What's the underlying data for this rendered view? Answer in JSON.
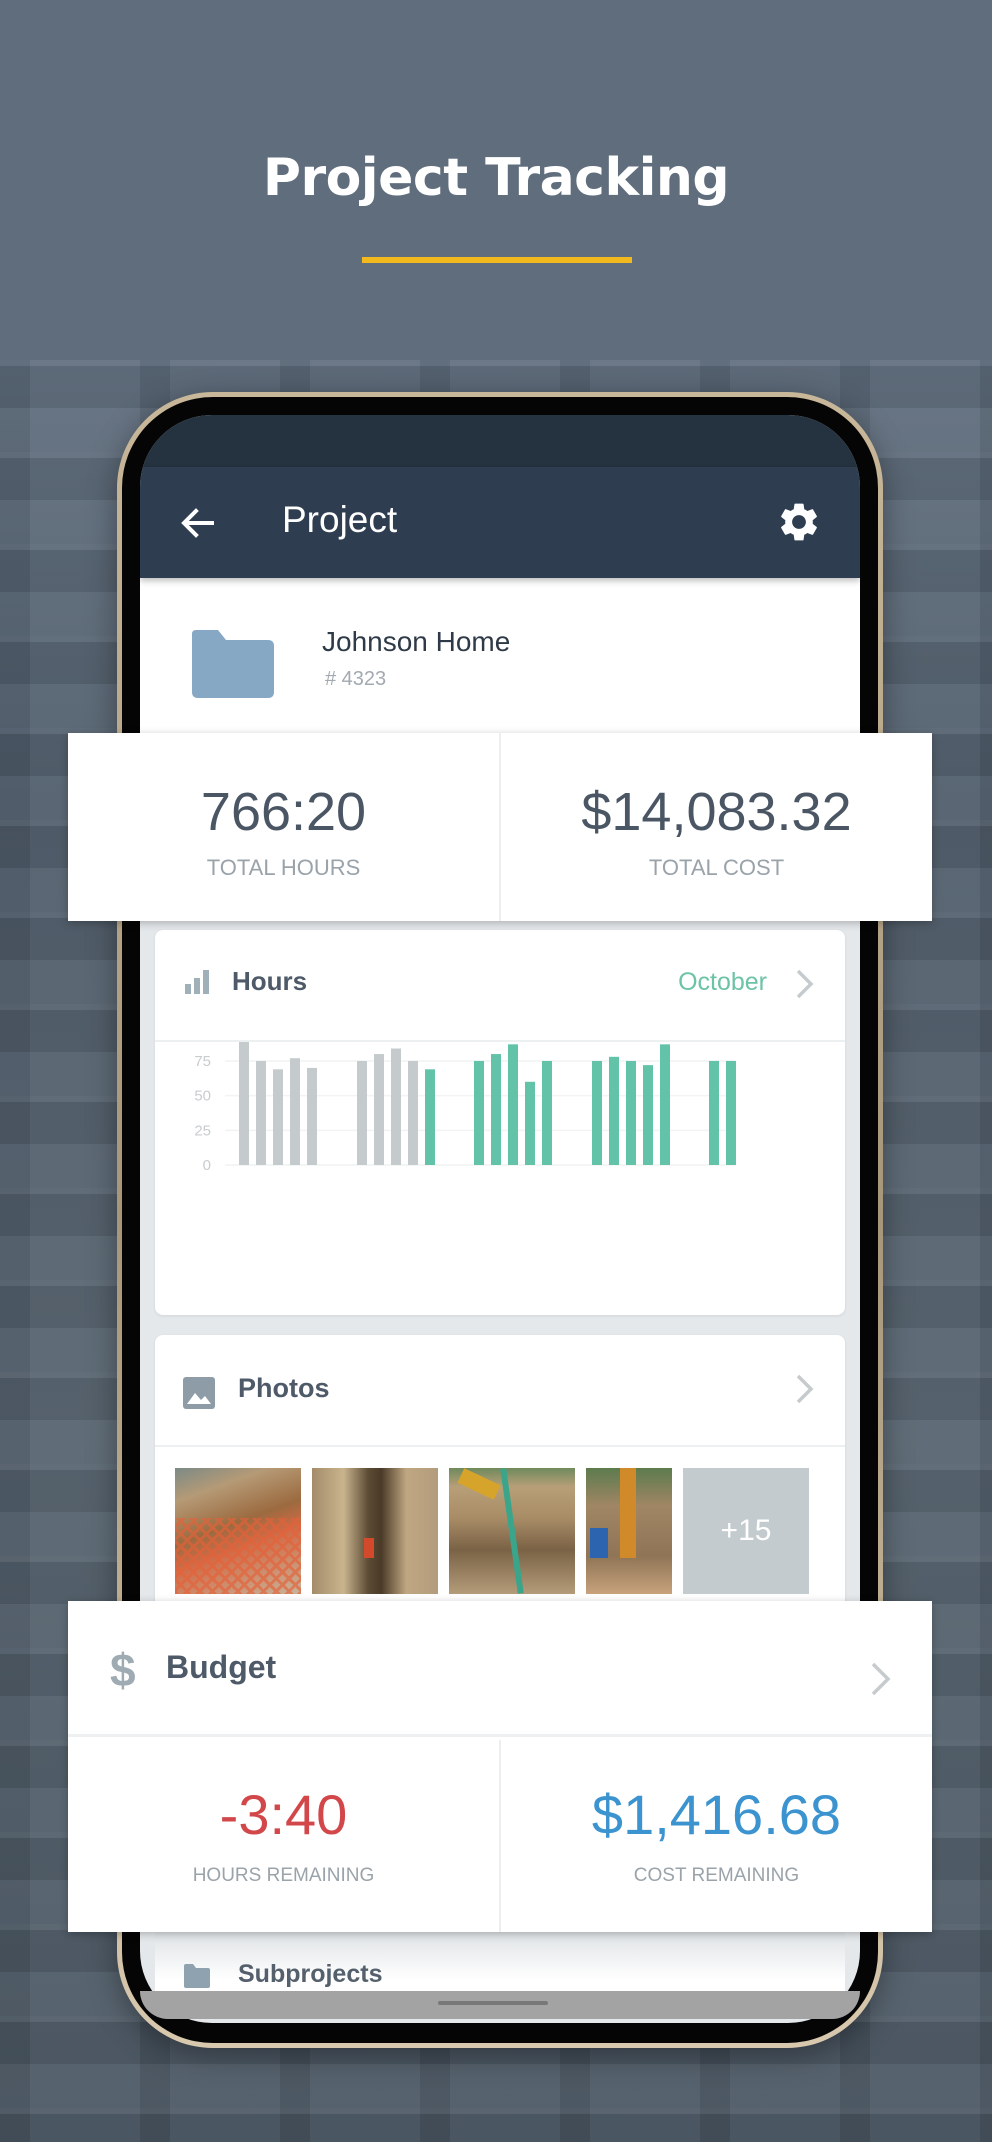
{
  "hero": {
    "title": "Project Tracking",
    "accent_color": "#f2b91e"
  },
  "app_bar": {
    "back_icon": "arrow-left-icon",
    "title": "Project",
    "settings_icon": "gear-icon"
  },
  "project": {
    "icon": "folder-icon",
    "name": "Johnson Home",
    "number": "# 4323"
  },
  "totals": {
    "hours_value": "766:20",
    "hours_label": "TOTAL HOURS",
    "cost_value": "$14,083.32",
    "cost_label": "TOTAL COST"
  },
  "hours_card": {
    "icon": "bar-chart-icon",
    "title": "Hours",
    "month": "October",
    "chevron_icon": "chevron-right-icon"
  },
  "chart_data": {
    "type": "bar",
    "title": "Hours",
    "xlabel": "",
    "ylabel": "",
    "ylim": [
      0,
      90
    ],
    "yticks": [
      0,
      25,
      50,
      75
    ],
    "grid": true,
    "legend": "none",
    "colors": {
      "past": "#c5cbcc",
      "current": "#62c3a9"
    },
    "groups": [
      {
        "values": [
          90,
          75,
          69,
          77,
          70
        ],
        "status": [
          "past",
          "past",
          "past",
          "past",
          "past"
        ]
      },
      {
        "values": [
          75,
          80,
          84,
          75,
          69
        ],
        "status": [
          "past",
          "past",
          "past",
          "past",
          "current"
        ]
      },
      {
        "values": [
          75,
          80,
          87,
          60,
          75
        ],
        "status": [
          "current",
          "current",
          "current",
          "current",
          "current"
        ]
      },
      {
        "values": [
          75,
          78,
          75,
          72,
          87
        ],
        "status": [
          "current",
          "current",
          "current",
          "current",
          "current"
        ]
      },
      {
        "values": [
          75,
          75
        ],
        "status": [
          "current",
          "current"
        ]
      }
    ]
  },
  "photos_card": {
    "icon": "image-icon",
    "title": "Photos",
    "chevron_icon": "chevron-right-icon",
    "thumbnails": [
      {
        "alt": "excavation with orange safety fence"
      },
      {
        "alt": "trench shoring with worker"
      },
      {
        "alt": "excavator trench with green pipe"
      },
      {
        "alt": "workers at excavator bucket"
      }
    ],
    "more_count": "+15"
  },
  "budget": {
    "icon": "dollar-icon",
    "title": "Budget",
    "chevron_icon": "chevron-right-icon",
    "hours_remaining_value": "-3:40",
    "hours_remaining_label": "HOURS REMAINING",
    "cost_remaining_value": "$1,416.68",
    "cost_remaining_label": "COST REMAINING",
    "negative_color": "#d2474a",
    "positive_color": "#3b93d0"
  },
  "subprojects": {
    "icon": "folder-icon",
    "label": "Subprojects"
  }
}
